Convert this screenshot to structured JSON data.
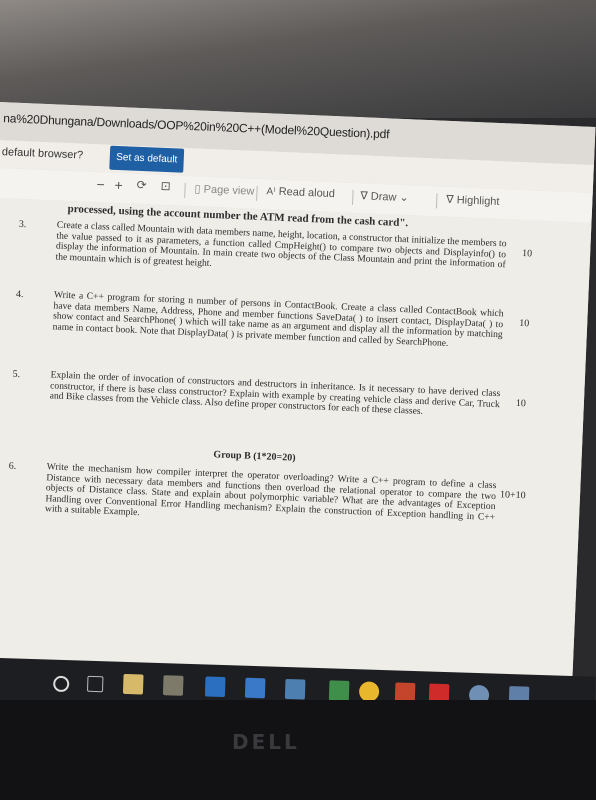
{
  "browser": {
    "url": "na%20Dhungana/Downloads/OOP%20in%20C++(Model%20Question).pdf",
    "default_prompt": "default browser?",
    "set_default_label": "Set as default"
  },
  "pdf_toolbar": {
    "zoom_out": "−",
    "zoom_in": "+",
    "page_view_label": "Page view",
    "read_aloud_label": "Read aloud",
    "draw_label": "Draw",
    "highlight_label": "Highlight"
  },
  "document": {
    "prev_line": "processed, using the account number the ATM read from the cash card\".",
    "questions": [
      {
        "number": "3.",
        "text": "Create a class called Mountain with data members name, height, location, a constructor that initialize the members to the value passed to it as parameters, a function called CmpHeight() to compare two objects and Displayinfo() to display the information of Mountain. In main create two objects of the Class Mountain and print the information of the mountain which is of greatest height.",
        "marks": "10"
      },
      {
        "number": "4.",
        "text": "Write a C++ program for storing n number of persons in ContactBook. Create a class called ContactBook which have data members Name, Address, Phone and member functions SaveData( ) to insert contact, DisplayData( ) to show contact and SearchPhone( ) which will take name as an argument and display all the information by matching name in contact book. Note that DisplayData( ) is private member function and called by SearchPhone.",
        "marks": "10"
      },
      {
        "number": "5.",
        "text": "Explain the order of invocation of constructors and destructors in inheritance. Is it necessary to have derived class constructor, if there is base class constructor? Explain with example by creating vehicle class and derive Car, Truck and Bike classes from the Vehicle class. Also define proper constructors for each of these classes.",
        "marks": "10"
      },
      {
        "number": "6.",
        "text": "Write the mechanism how compiler interpret the operator overloading? Write a C++ program to define a class Distance with necessary data members and functions then overload the relational operator to compare the two objects of Distance class. State and explain about polymorphic variable? What are the advantages of Exception Handling over Conventional Error Handling mechanism? Explain the construction of Exception handling in C++ with a suitable Example.",
        "marks": "10+10"
      }
    ],
    "group_b_heading": "Group B (1*20=20)"
  },
  "laptop": {
    "brand_logo": "DELL"
  },
  "colors": {
    "set_default_bg": "#1f5fa3",
    "page_bg": "#efede8",
    "taskbar": "#1d1e22"
  },
  "taskbar_icons": [
    "cortana-circle-icon",
    "task-view-icon",
    "file-explorer-icon",
    "store-icon",
    "edge-icon",
    "mail-icon",
    "photos-icon",
    "chrome-icon",
    "powerpoint-icon",
    "acrobat-icon",
    "settings-icon",
    "people-icon"
  ]
}
